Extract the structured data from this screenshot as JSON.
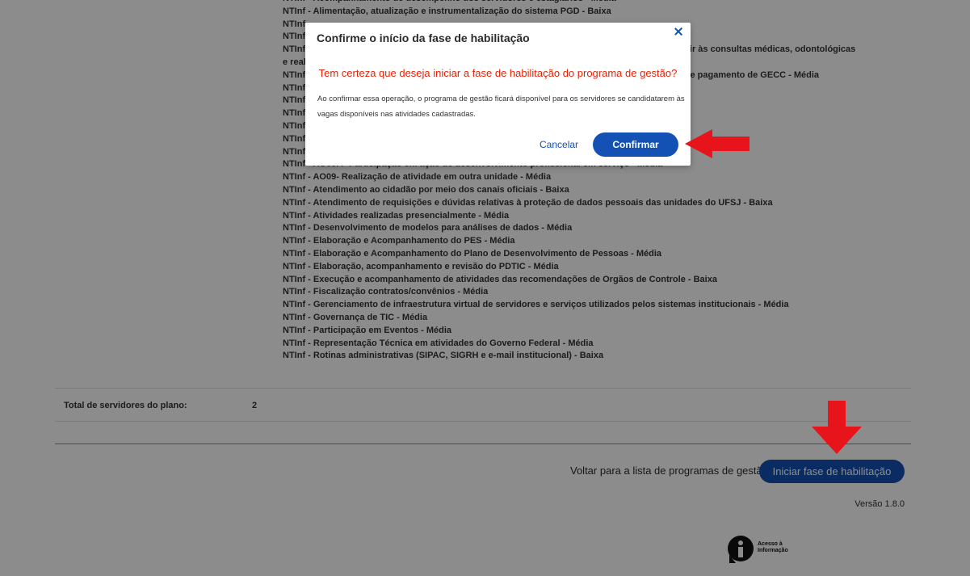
{
  "activities": [
    "NTInf - Acompanhamento de desempenho dos servidores e estagiários - Média",
    "NTInf - Alimentação, atualização e instrumentalização do sistema PGD - Baixa",
    "NTInf",
    "NTInf",
    "NTInf - Atendimento de demandas de agendamento de servidores relativas ao afastamento para ir às consultas médicas, odontológicas",
    "e realização de exames",
    "NTInf - Atendimento, processamento e acompanhamento de demandas relativas a solicitações de pagamento de GECC - Média",
    "NTInf",
    "NTInf",
    "NTInf",
    "NTInf",
    "NTInf",
    "NTInf",
    "NTInf - AO08.4- Participação em ação de desenvolvimento profissional em serviço - Média",
    "NTInf - AO09- Realização de atividade em outra unidade - Média",
    "NTInf - Atendimento ao cidadão por meio dos canais oficiais - Baixa",
    "NTInf - Atendimento de requisições e dúvidas relativas à proteção de dados pessoais das unidades do UFSJ - Baixa",
    "NTInf - Atividades realizadas presencialmente - Média",
    "NTInf - Desenvolvimento de modelos para análises de dados - Média",
    "NTInf - Elaboração e Acompanhamento do PES - Média",
    "NTInf - Elaboração e Acompanhamento do Plano de Desenvolvimento de Pessoas - Média",
    "NTInf - Elaboração, acompanhamento e revisão do PDTIC - Média",
    "NTInf - Execução e acompanhamento de atividades das recomendações de Orgãos de Controle - Baixa",
    "NTInf - Fiscalização contratos/convênios - Média",
    "NTInf - Gerenciamento de infraestrutura virtual de servidores e serviços utilizados pelos sistemas institucionais - Média",
    "NTInf - Governança de TIC - Média",
    "NTInf - Participação em Eventos - Média",
    "NTInf - Representação Técnica em atividades do Governo Federal - Média",
    "NTInf - Rotinas administrativas (SIPAC, SIGRH e e-mail institucional) - Baixa"
  ],
  "total": {
    "label": "Total de servidores do plano:",
    "value": "2"
  },
  "actions": {
    "back_label": "Voltar para a lista de programas de gestão",
    "start_label": "Iniciar fase de habilitação"
  },
  "version": "Versão 1.8.0",
  "footer": {
    "info_line1": "Acesso à",
    "info_line2": "Informação"
  },
  "modal": {
    "title": "Confirme o início da fase de habilitação",
    "question": "Tem certeza que deseja iniciar a fase de habilitação do programa de gestão?",
    "body": "Ao confirmar essa operação, o programa de gestão ficará disponível para os servidores se candidatarem às vagas disponíveis nas atividades cadastradas.",
    "cancel_label": "Cancelar",
    "confirm_label": "Confirmar"
  },
  "colors": {
    "primary": "#1351b4",
    "alert": "#e52207",
    "annotation_arrow": "#e8141b"
  }
}
